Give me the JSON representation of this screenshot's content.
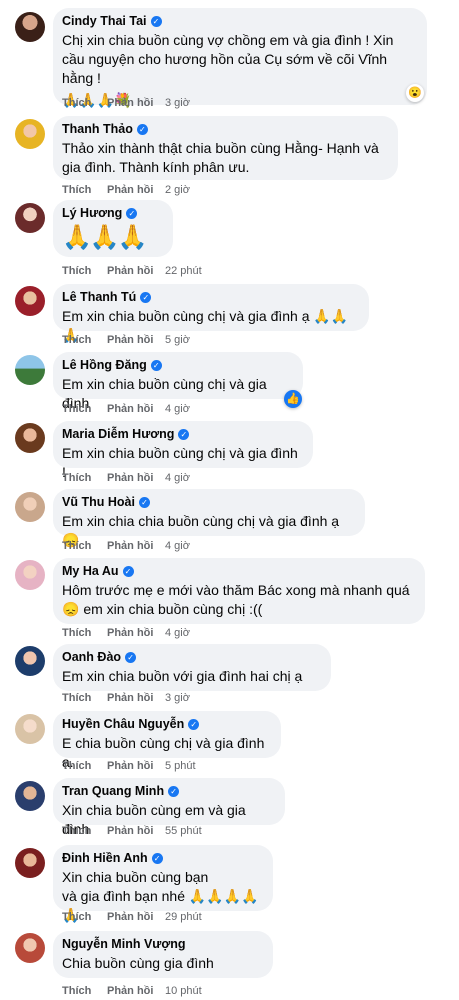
{
  "actions": {
    "like": "Thích",
    "reply": "Phản hồi"
  },
  "comments": [
    {
      "name": "Cindy Thai Tai",
      "text": "Chị xin chia buồn cùng vợ chồng em và gia đình ! Xin cầu nguyện cho hương hồn của Cụ sớm về cõi Vĩnh hằng !",
      "emoji": "🙏🙏🙏💐",
      "time": "3 giờ",
      "reaction": "😮"
    },
    {
      "name": "Thanh Thảo",
      "text": "Thảo xin thành thật chia buồn cùng Hằng- Hạnh và gia đình. Thành kính phân ưu.",
      "time": "2 giờ"
    },
    {
      "name": "Lý Hương",
      "emoji": "🙏🙏🙏",
      "time": "22 phút"
    },
    {
      "name": "Lê Thanh Tú",
      "text": "Em xin chia buồn cùng chị và gia đình ạ",
      "emoji": "🙏🙏🙏",
      "time": "5 giờ"
    },
    {
      "name": "Lê Hồng Đăng",
      "text": "Em xin chia buồn cùng chị và gia đình",
      "time": "4 giờ",
      "reaction": "👍"
    },
    {
      "name": "Maria Diễm Hương",
      "text": "Em xin chia buồn cùng chị và gia đình !",
      "time": "4 giờ"
    },
    {
      "name": "Vũ Thu Hoài",
      "text": "Em xin chia chia buồn cùng chị và gia đình ạ",
      "emoji": "😞",
      "time": "4 giờ"
    },
    {
      "name": "My Ha Au",
      "text": "Hôm trước mẹ e mới vào thăm Bác xong mà nhanh quá",
      "text2": "em xin chia buồn cùng chị :((",
      "emoji": "😞",
      "time": "4 giờ"
    },
    {
      "name": "Oanh Đào",
      "text": "Em xin chia buồn với gia đình hai chị ạ",
      "time": "3 giờ"
    },
    {
      "name": "Huyền Châu Nguyễn",
      "text": "E chia buồn cùng chị và gia đình ạ.",
      "time": "5 phút"
    },
    {
      "name": "Tran Quang Minh",
      "text": "Xin chia buồn cùng em và gia đình",
      "time": "55 phút"
    },
    {
      "name": "Đinh Hiền Anh",
      "text": "Xin chia buồn cùng bạn",
      "text2": "và gia đình bạn nhé",
      "emoji": "🙏🙏🙏🙏🙏",
      "time": "29 phút"
    },
    {
      "name": "Nguyễn Minh Vượng",
      "text": "Chia buồn cùng gia đình",
      "time": "10 phút"
    }
  ],
  "colors": {
    "bubble": "#f0f2f5",
    "verified": "#1877f2",
    "meta": "#65676b"
  }
}
